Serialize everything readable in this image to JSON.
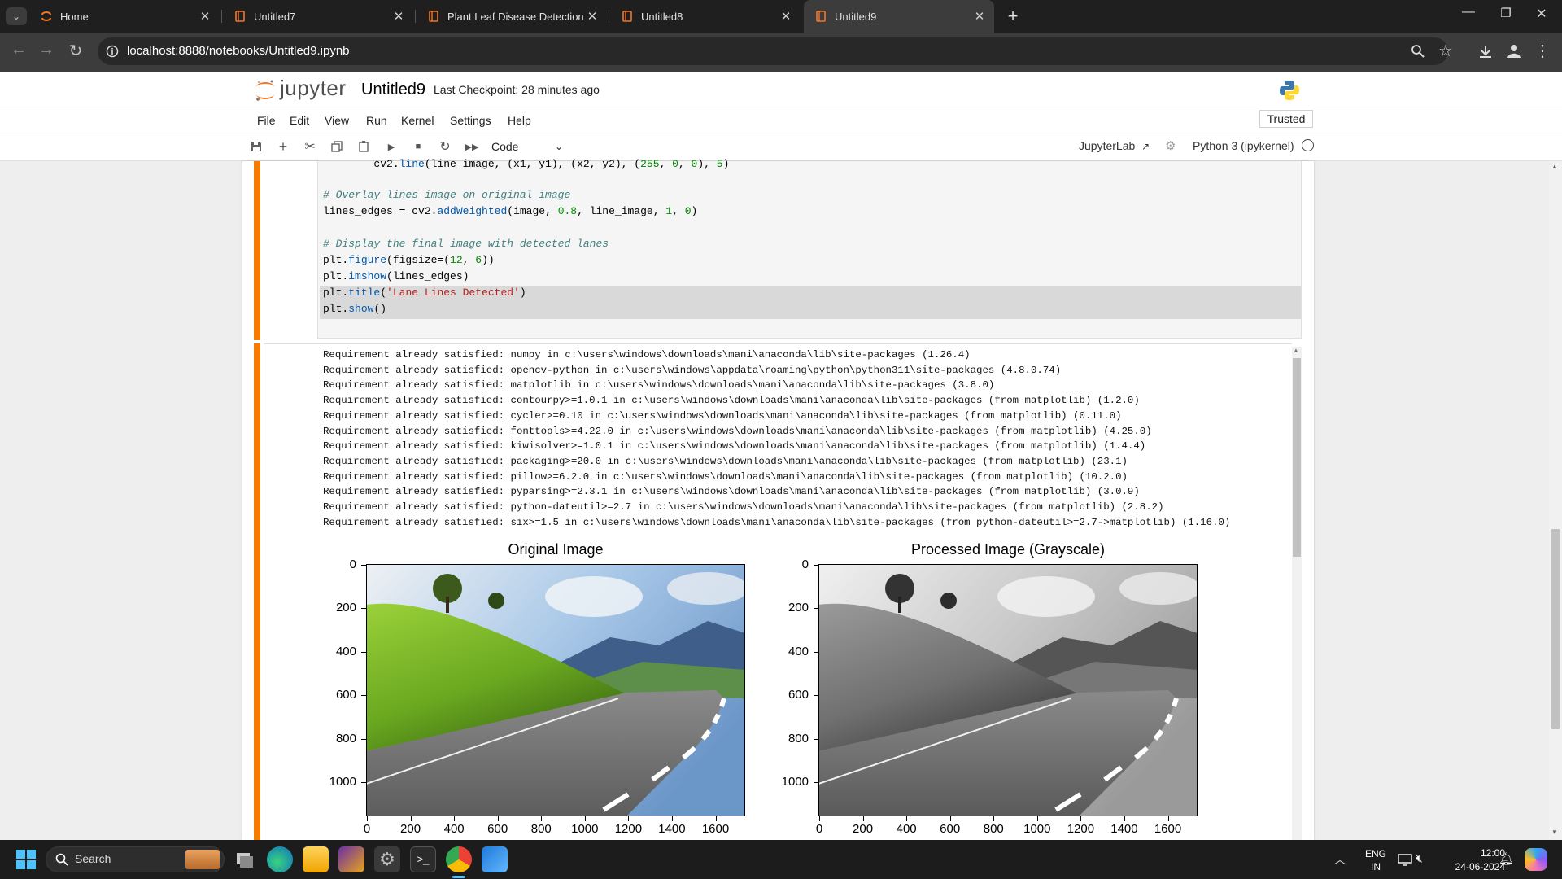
{
  "browser": {
    "tabs": [
      {
        "title": "Home",
        "active": false
      },
      {
        "title": "Untitled7",
        "active": false
      },
      {
        "title": "Plant Leaf Disease Detection Sy",
        "active": false
      },
      {
        "title": "Untitled8",
        "active": false
      },
      {
        "title": "Untitled9",
        "active": true
      }
    ],
    "url": "localhost:8888/notebooks/Untitled9.ipynb"
  },
  "jupyter": {
    "logo_text": "jupyter",
    "notebook_name": "Untitled9",
    "checkpoint": "Last Checkpoint: 28 minutes ago",
    "menu": [
      "File",
      "Edit",
      "View",
      "Run",
      "Kernel",
      "Settings",
      "Help"
    ],
    "trusted": "Trusted",
    "cell_type": "Code",
    "jupyterlab": "JupyterLab",
    "kernel": "Python 3 (ipykernel)"
  },
  "code_cell": {
    "lines": [
      "        cv2.line(line_image, (x1, y1), (x2, y2), (255, 0, 0), 5)",
      "",
      "# Overlay lines image on original image",
      "lines_edges = cv2.addWeighted(image, 0.8, line_image, 1, 0)",
      "",
      "# Display the final image with detected lanes",
      "plt.figure(figsize=(12, 6))",
      "plt.imshow(lines_edges)",
      "plt.title('Lane Lines Detected')",
      "plt.show()"
    ]
  },
  "output": {
    "lines": [
      "Requirement already satisfied: numpy in c:\\users\\windows\\downloads\\mani\\anaconda\\lib\\site-packages (1.26.4)",
      "Requirement already satisfied: opencv-python in c:\\users\\windows\\appdata\\roaming\\python\\python311\\site-packages (4.8.0.74)",
      "Requirement already satisfied: matplotlib in c:\\users\\windows\\downloads\\mani\\anaconda\\lib\\site-packages (3.8.0)",
      "Requirement already satisfied: contourpy>=1.0.1 in c:\\users\\windows\\downloads\\mani\\anaconda\\lib\\site-packages (from matplotlib) (1.2.0)",
      "Requirement already satisfied: cycler>=0.10 in c:\\users\\windows\\downloads\\mani\\anaconda\\lib\\site-packages (from matplotlib) (0.11.0)",
      "Requirement already satisfied: fonttools>=4.22.0 in c:\\users\\windows\\downloads\\mani\\anaconda\\lib\\site-packages (from matplotlib) (4.25.0)",
      "Requirement already satisfied: kiwisolver>=1.0.1 in c:\\users\\windows\\downloads\\mani\\anaconda\\lib\\site-packages (from matplotlib) (1.4.4)",
      "Requirement already satisfied: packaging>=20.0 in c:\\users\\windows\\downloads\\mani\\anaconda\\lib\\site-packages (from matplotlib) (23.1)",
      "Requirement already satisfied: pillow>=6.2.0 in c:\\users\\windows\\downloads\\mani\\anaconda\\lib\\site-packages (from matplotlib) (10.2.0)",
      "Requirement already satisfied: pyparsing>=2.3.1 in c:\\users\\windows\\downloads\\mani\\anaconda\\lib\\site-packages (from matplotlib) (3.0.9)",
      "Requirement already satisfied: python-dateutil>=2.7 in c:\\users\\windows\\downloads\\mani\\anaconda\\lib\\site-packages (from matplotlib) (2.8.2)",
      "Requirement already satisfied: six>=1.5 in c:\\users\\windows\\downloads\\mani\\anaconda\\lib\\site-packages (from python-dateutil>=2.7->matplotlib) (1.16.0)"
    ]
  },
  "figure": {
    "left_title": "Original Image",
    "right_title": "Processed Image (Grayscale)",
    "y_ticks": [
      "0",
      "200",
      "400",
      "600",
      "800",
      "1000"
    ],
    "x_ticks": [
      "0",
      "200",
      "400",
      "600",
      "800",
      "1000",
      "1200",
      "1400",
      "1600"
    ]
  },
  "taskbar": {
    "search": "Search",
    "lang_top": "ENG",
    "lang_bottom": "IN",
    "time": "12:00",
    "date": "24-06-2024"
  },
  "colors": {
    "accent": "#f37726",
    "active_cell_bar": "#f57c00"
  }
}
